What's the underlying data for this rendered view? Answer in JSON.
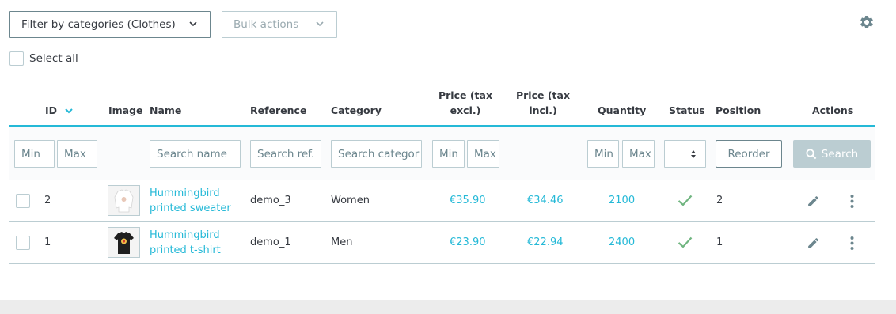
{
  "toolbar": {
    "filter_label": "Filter by categories (Clothes)",
    "bulk_label": "Bulk actions"
  },
  "select_all_label": "Select all",
  "columns": {
    "id": "ID",
    "image": "Image",
    "name": "Name",
    "reference": "Reference",
    "category": "Category",
    "price_excl_1": "Price (tax",
    "price_excl_2": "excl.)",
    "price_incl_1": "Price (tax",
    "price_incl_2": "incl.)",
    "quantity": "Quantity",
    "status": "Status",
    "position": "Position",
    "actions": "Actions"
  },
  "filters": {
    "id_min": "Min",
    "id_max": "Max",
    "name": "Search name",
    "reference": "Search ref.",
    "category": "Search categor",
    "price_min": "Min",
    "price_max": "Max",
    "qty_min": "Min",
    "qty_max": "Max",
    "reorder": "Reorder",
    "search": "Search"
  },
  "rows": [
    {
      "id": "2",
      "name_line1": "Hummingbird",
      "name_line2": "printed sweater",
      "reference": "demo_3",
      "category": "Women",
      "price_excl": "€35.90",
      "price_incl": "€34.46",
      "quantity": "2100",
      "status": "enabled",
      "position": "2",
      "thumb": "sweater-thumbnail"
    },
    {
      "id": "1",
      "name_line1": "Hummingbird",
      "name_line2": "printed t-shirt",
      "reference": "demo_1",
      "category": "Men",
      "price_excl": "€23.90",
      "price_incl": "€22.94",
      "quantity": "2400",
      "status": "enabled",
      "position": "1",
      "thumb": "tshirt-thumbnail"
    }
  ],
  "colors": {
    "accent": "#25b9d7",
    "border": "#bbcdd2",
    "text": "#363a41",
    "success": "#70b580"
  },
  "icons": [
    "chevron-down-icon",
    "gear-icon",
    "sort-desc-icon",
    "search-icon",
    "edit-icon",
    "more-vertical-icon",
    "check-icon",
    "select-arrows-icon"
  ]
}
